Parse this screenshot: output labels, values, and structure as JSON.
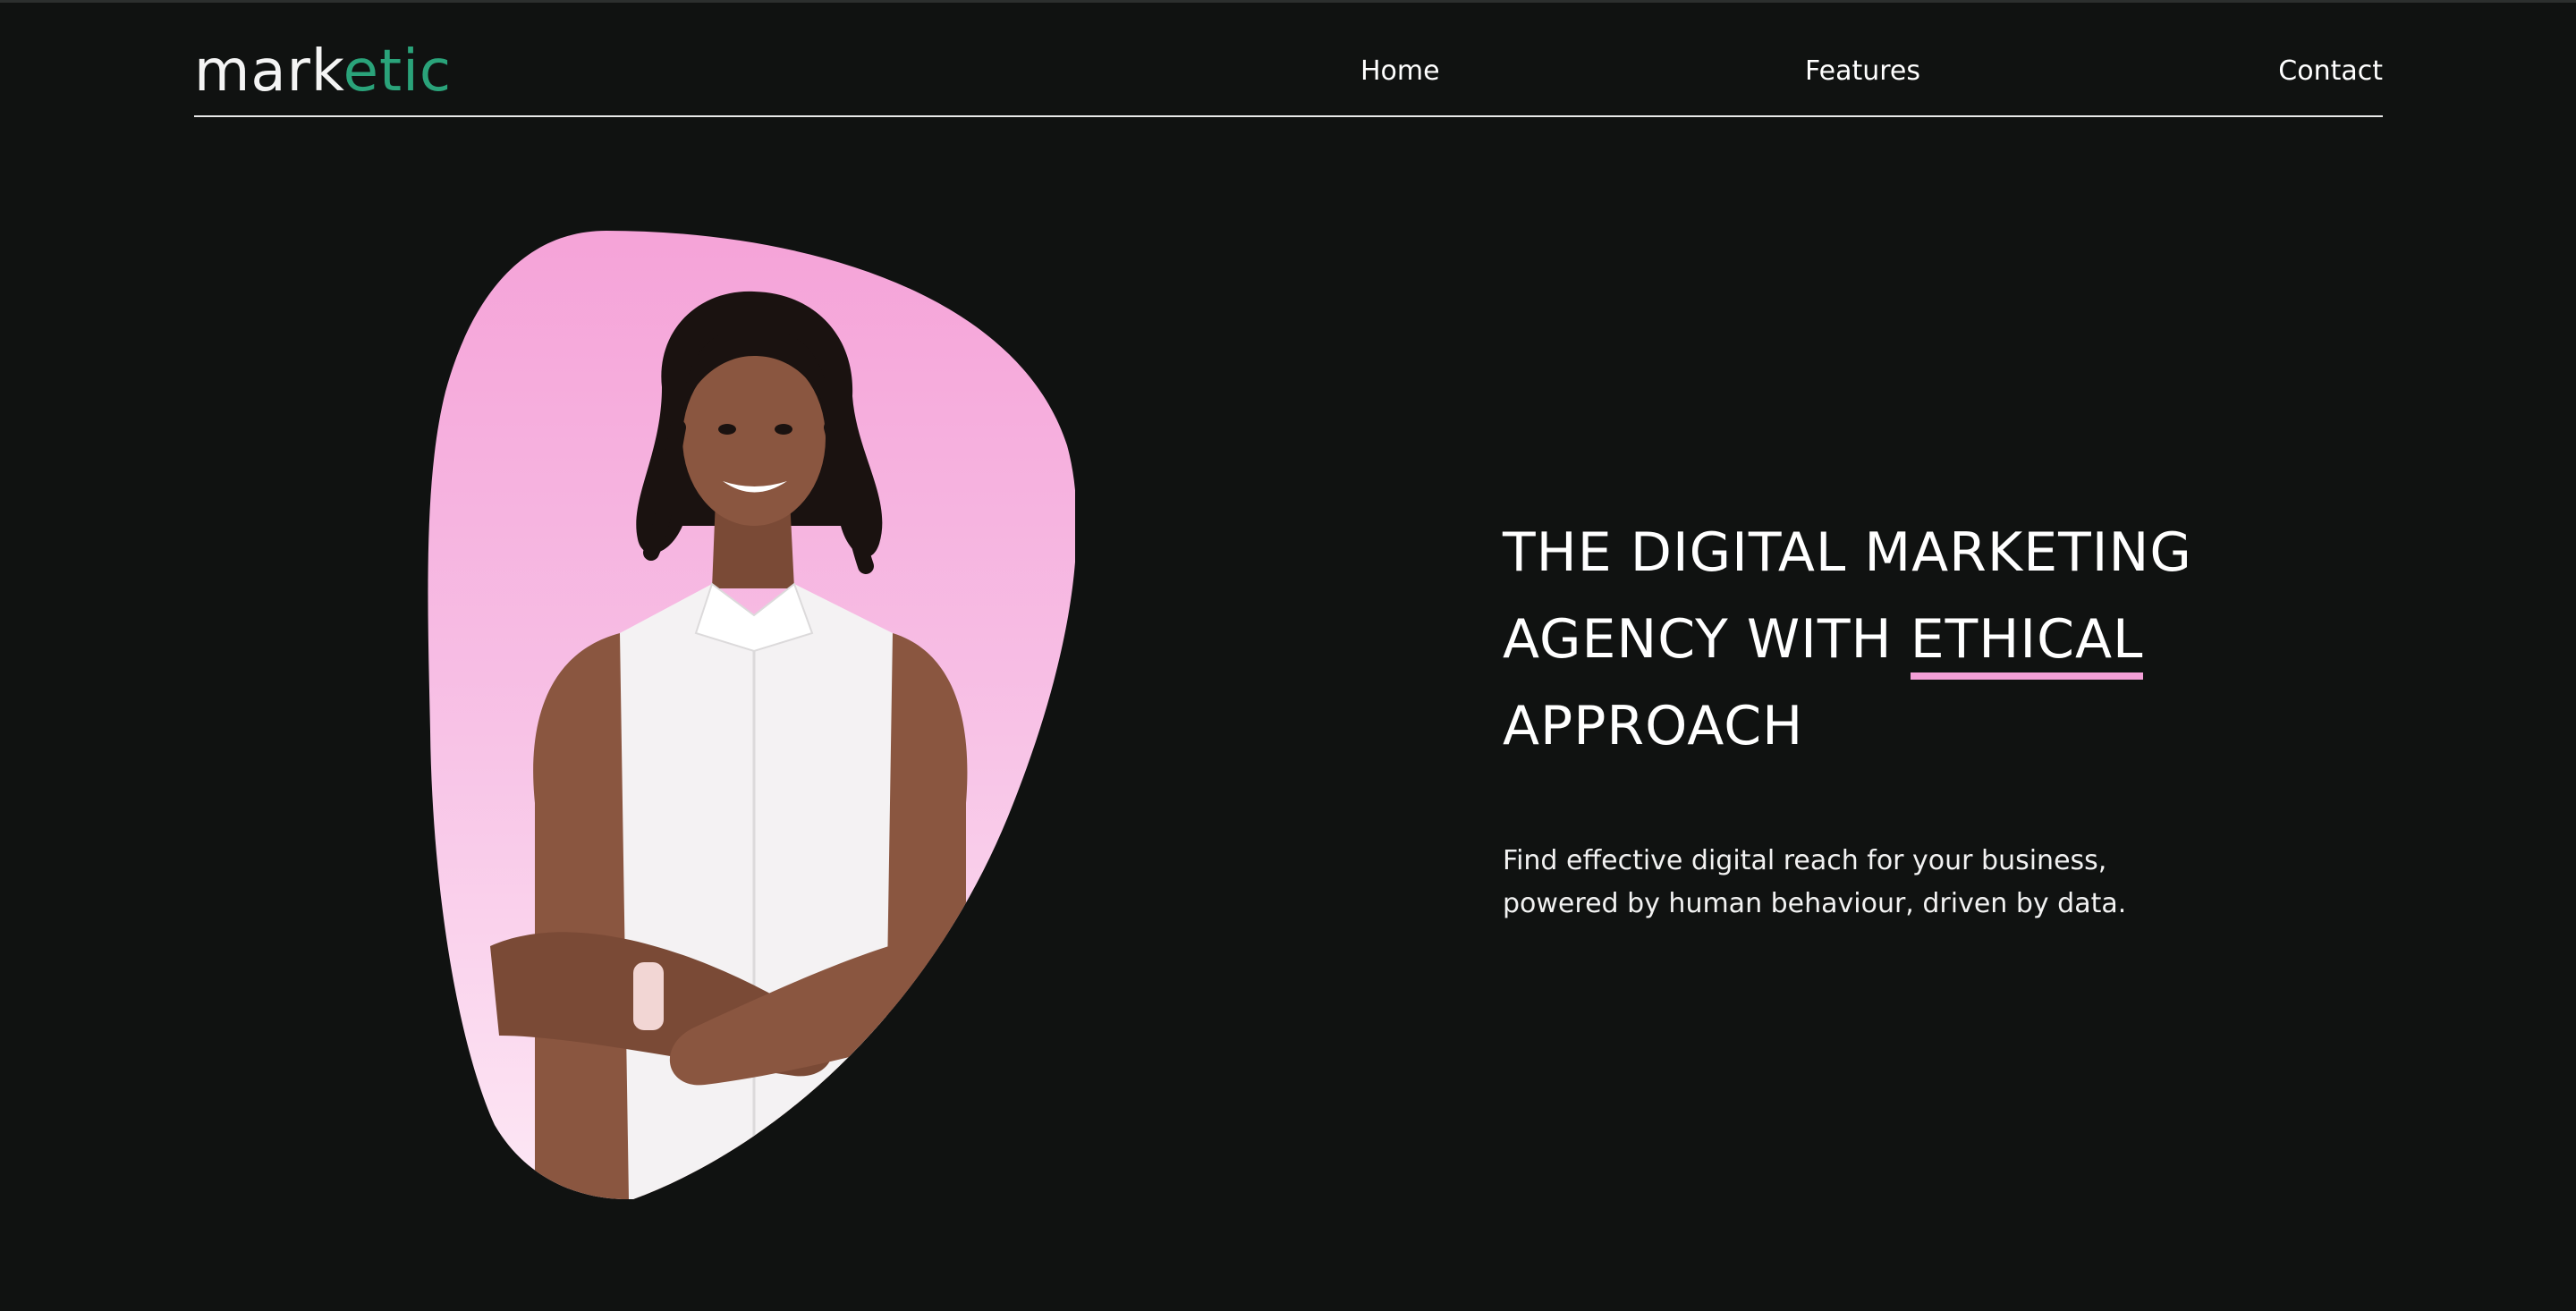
{
  "header": {
    "logo": {
      "part1": "mark",
      "part2": "etic"
    },
    "nav": [
      {
        "label": "Home"
      },
      {
        "label": "Features"
      },
      {
        "label": "Contact"
      }
    ]
  },
  "hero": {
    "headline_line1": "THE DIGITAL MARKETING",
    "headline_line2_prefix": "AGENCY WITH ",
    "headline_line2_accent": "ETHICAL",
    "headline_line3": "APPROACH",
    "subtext_line1": "Find effective digital reach for your business,",
    "subtext_line2": "powered by human behaviour, driven by data.",
    "image": "woman-portrait-arms-crossed"
  },
  "colors": {
    "background": "#101211",
    "brand_green": "#2aa37a",
    "accent_pink": "#f39fd7",
    "text": "#ffffff"
  }
}
